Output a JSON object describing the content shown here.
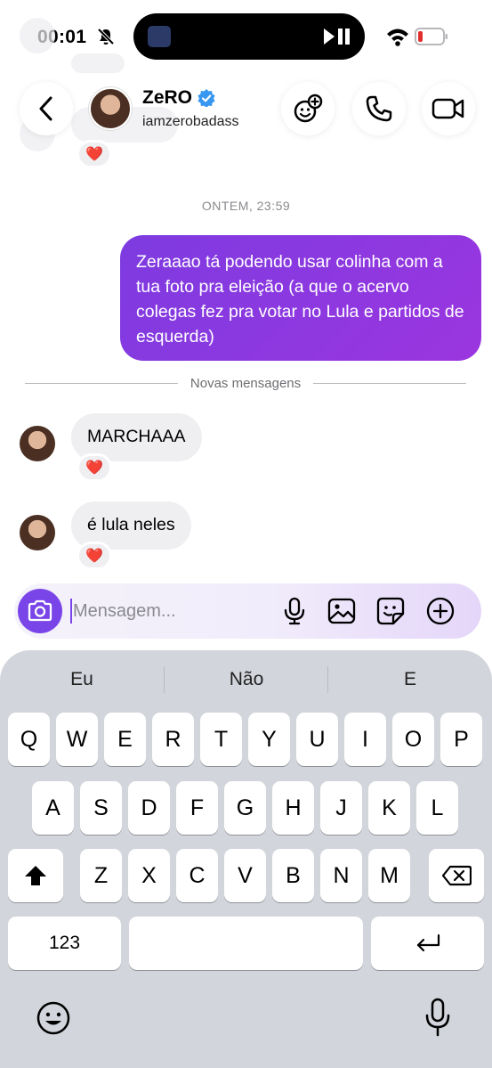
{
  "status_bar": {
    "time": "00:01"
  },
  "header": {
    "contact_name": "ZeRO",
    "contact_handle": "iamzerobadass"
  },
  "chat": {
    "timestamp": "ONTEM, 23:59",
    "sent_message": "Zeraaao tá podendo usar colinha com a tua foto pra eleição (a que o acervo colegas fez pra votar no Lula e partidos de esquerda)",
    "new_messages_divider": "Novas mensagens",
    "received": [
      {
        "text": "MARCHAAA",
        "reaction": "❤️"
      },
      {
        "text": "é lula neles",
        "reaction": "❤️"
      }
    ],
    "top_reaction": "❤️"
  },
  "composer": {
    "placeholder": "Mensagem..."
  },
  "keyboard": {
    "suggestions": [
      "Eu",
      "Não",
      "E"
    ],
    "row1": [
      "Q",
      "W",
      "E",
      "R",
      "T",
      "Y",
      "U",
      "I",
      "O",
      "P"
    ],
    "row2": [
      "A",
      "S",
      "D",
      "F",
      "G",
      "H",
      "J",
      "K",
      "L"
    ],
    "row3": [
      "Z",
      "X",
      "C",
      "V",
      "B",
      "N",
      "M"
    ],
    "numbers_key": "123"
  },
  "colors": {
    "accent": "#7a45e8",
    "sent_bubble": "#8a39e0",
    "received_bubble": "#efeff2",
    "keyboard_bg": "#d3d5dc"
  },
  "icons": [
    "bell-slash-icon",
    "wifi-icon",
    "battery-icon",
    "back-chevron-icon",
    "verified-icon",
    "effects-icon",
    "phone-icon",
    "video-icon",
    "camera-icon",
    "microphone-icon",
    "image-icon",
    "sticker-icon",
    "plus-circle-icon",
    "shift-icon",
    "backspace-icon",
    "return-icon",
    "emoji-icon"
  ]
}
